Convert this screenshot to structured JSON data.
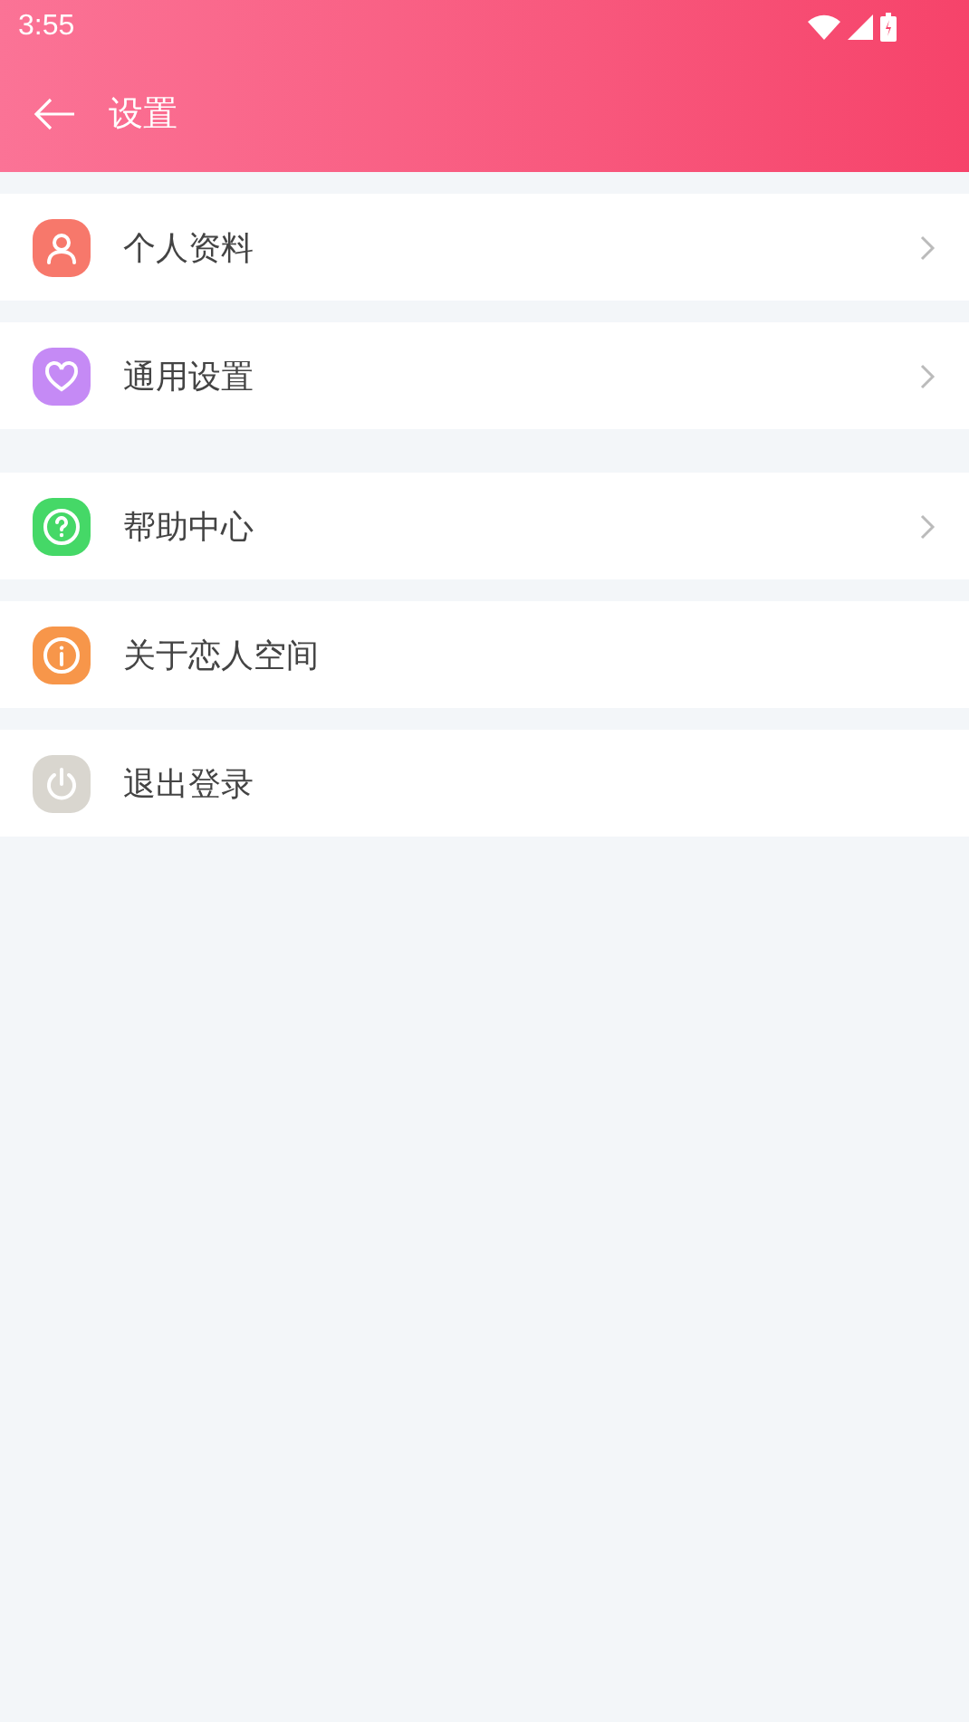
{
  "status_bar": {
    "time": "3:55"
  },
  "header": {
    "title": "设置"
  },
  "sections": [
    {
      "items": [
        {
          "label": "个人资料",
          "kind": "person",
          "color": "#f7786b",
          "chevron": true
        },
        {
          "label": "通用设置",
          "kind": "heart",
          "color": "#c58af5",
          "chevron": true
        }
      ]
    },
    {
      "items": [
        {
          "label": "帮助中心",
          "kind": "help",
          "color": "#45d867",
          "chevron": true
        },
        {
          "label": "关于恋人空间",
          "kind": "info",
          "color": "#f7964a",
          "chevron": false
        },
        {
          "label": "退出登录",
          "kind": "power",
          "color": "#d9d6cf",
          "chevron": false
        }
      ]
    }
  ]
}
